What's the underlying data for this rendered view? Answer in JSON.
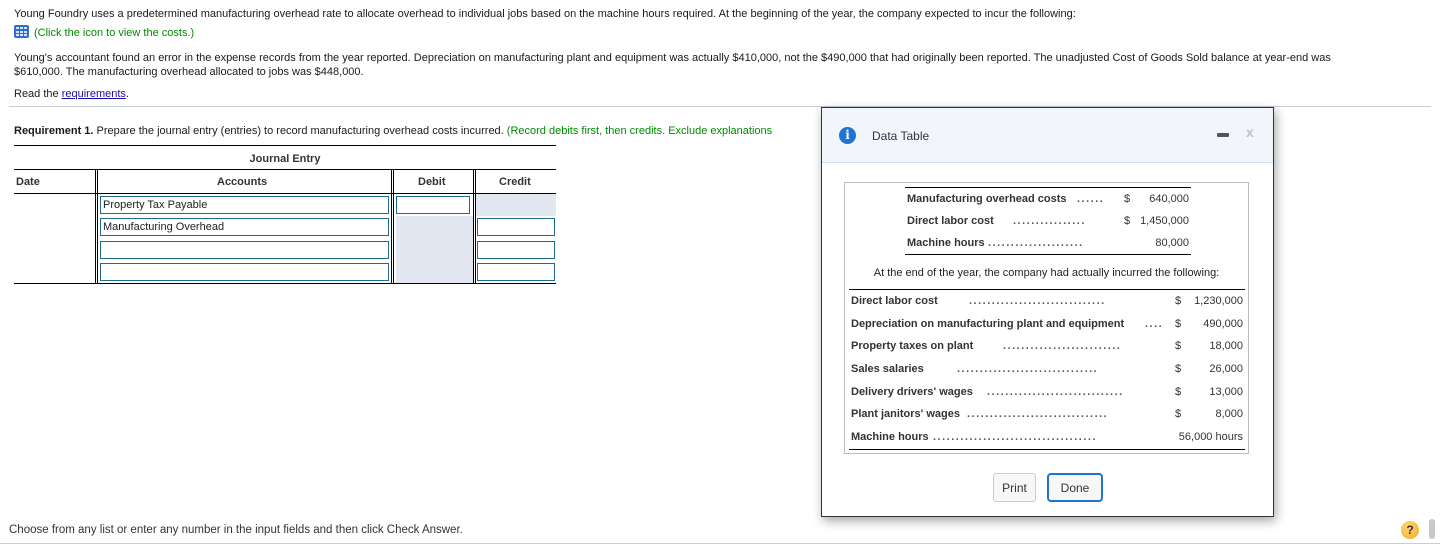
{
  "problem": {
    "intro": "Young Foundry uses a predetermined manufacturing overhead rate to allocate overhead to individual jobs based on the machine hours required. At the beginning of the year, the company expected to incur the following:",
    "icon_hint": "(Click the icon to view the costs.)",
    "icon": "table-grid-icon",
    "error_note_line1": "Young's accountant found an error in the expense records from the year reported. Depreciation on manufacturing plant and equipment was actually $410,000, not the $490,000 that had originally been reported. The unadjusted Cost of Goods Sold balance at year-end was",
    "error_note_line2": "$610,000. The manufacturing overhead allocated to jobs was $448,000.",
    "read_prefix": "Read the ",
    "read_link": "requirements",
    "read_suffix": "."
  },
  "requirement": {
    "label": "Requirement 1.",
    "text": " Prepare the journal entry (entries) to record manufacturing overhead costs incurred. ",
    "hint": "(Record debits first, then credits. Exclude explanations"
  },
  "journal": {
    "title": "Journal Entry",
    "headers": {
      "date": "Date",
      "accounts": "Accounts",
      "debit": "Debit",
      "credit": "Credit"
    },
    "rows": [
      {
        "account": "Property Tax Payable",
        "debit": "",
        "credit": null
      },
      {
        "account": "Manufacturing Overhead",
        "debit": null,
        "credit": ""
      },
      {
        "account": "",
        "debit": null,
        "credit": ""
      },
      {
        "account": "",
        "debit": null,
        "credit": ""
      }
    ]
  },
  "footer": {
    "instruction": "Choose from any list or enter any number in the input fields and then click Check Answer.",
    "help_label": "?"
  },
  "modal": {
    "title": "Data Table",
    "info_icon": "i",
    "close_label": "x",
    "expected": [
      {
        "label": "Manufacturing overhead costs",
        "dots": "......",
        "currency": "$",
        "value": "640,000"
      },
      {
        "label": "Direct labor cost",
        "dots": "................",
        "currency": "$",
        "value": "1,450,000"
      },
      {
        "label": "Machine hours",
        "dots": ".....................",
        "currency": "",
        "value": "80,000"
      }
    ],
    "actual_intro": "At the end of the year, the company had actually incurred the following:",
    "actual": [
      {
        "label": "Direct labor cost",
        "dots": "..............................",
        "currency": "$",
        "value": "1,230,000"
      },
      {
        "label": "Depreciation on manufacturing plant and equipment",
        "dots": "....",
        "currency": "$",
        "value": "490,000"
      },
      {
        "label": "Property taxes on plant",
        "dots": "..........................",
        "currency": "$",
        "value": "18,000"
      },
      {
        "label": "Sales salaries",
        "dots": "...............................",
        "currency": "$",
        "value": "26,000"
      },
      {
        "label": "Delivery drivers' wages",
        "dots": "..............................",
        "currency": "$",
        "value": "13,000"
      },
      {
        "label": "Plant janitors' wages",
        "dots": "...............................",
        "currency": "$",
        "value": "8,000"
      },
      {
        "label": "Machine hours",
        "dots": "....................................",
        "currency": "",
        "value": "56,000 hours"
      }
    ],
    "buttons": {
      "print": "Print",
      "done": "Done"
    }
  }
}
